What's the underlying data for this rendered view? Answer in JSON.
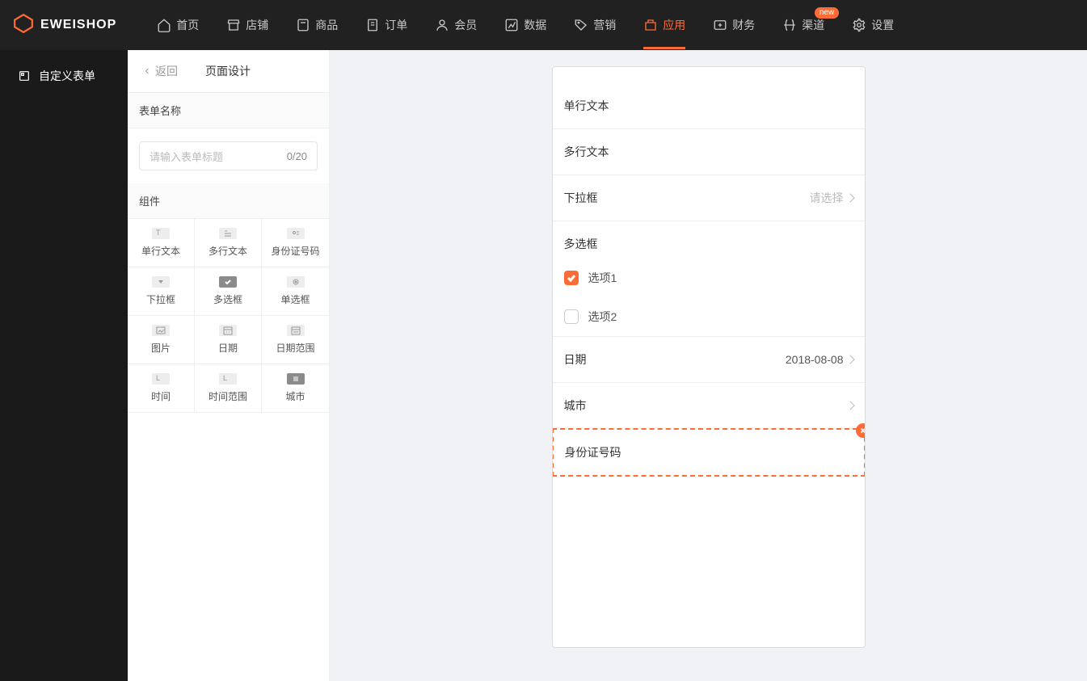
{
  "logo": {
    "text": "EWEISHOP"
  },
  "nav": {
    "items": [
      {
        "label": "首页",
        "icon": "home"
      },
      {
        "label": "店铺",
        "icon": "store"
      },
      {
        "label": "商品",
        "icon": "goods"
      },
      {
        "label": "订单",
        "icon": "order"
      },
      {
        "label": "会员",
        "icon": "member"
      },
      {
        "label": "数据",
        "icon": "chart"
      },
      {
        "label": "营销",
        "icon": "tag"
      },
      {
        "label": "应用",
        "icon": "app"
      },
      {
        "label": "财务",
        "icon": "finance"
      },
      {
        "label": "渠道",
        "icon": "channel",
        "badge": "new"
      },
      {
        "label": "设置",
        "icon": "settings"
      }
    ],
    "active_index": 7
  },
  "sidebar": {
    "item": "自定义表单"
  },
  "panel": {
    "back_label": "返回",
    "title": "页面设计",
    "form_name_label": "表单名称",
    "form_name_placeholder": "请输入表单标题",
    "form_name_counter": "0/20",
    "components_label": "组件",
    "components": [
      {
        "label": "单行文本"
      },
      {
        "label": "多行文本"
      },
      {
        "label": "身份证号码"
      },
      {
        "label": "下拉框"
      },
      {
        "label": "多选框"
      },
      {
        "label": "单选框"
      },
      {
        "label": "图片"
      },
      {
        "label": "日期"
      },
      {
        "label": "日期范围"
      },
      {
        "label": "时间"
      },
      {
        "label": "时间范围"
      },
      {
        "label": "城市"
      }
    ]
  },
  "preview": {
    "single_text": "单行文本",
    "multi_text": "多行文本",
    "dropdown": {
      "label": "下拉框",
      "value": "请选择"
    },
    "checkbox": {
      "label": "多选框",
      "options": [
        "选项1",
        "选项2"
      ],
      "checked_index": 0
    },
    "date": {
      "label": "日期",
      "value": "2018-08-08"
    },
    "city": {
      "label": "城市"
    },
    "idcard": {
      "label": "身份证号码"
    }
  }
}
